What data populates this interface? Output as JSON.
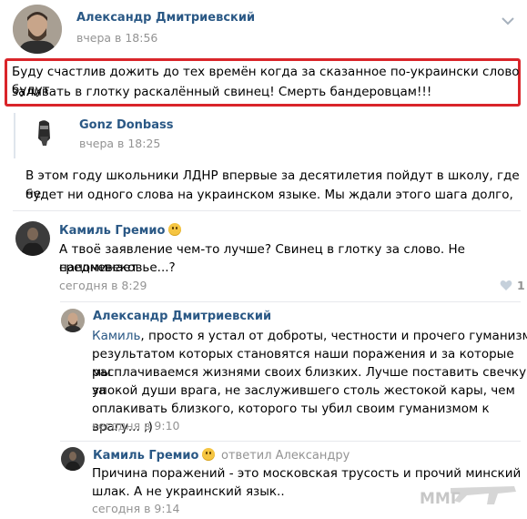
{
  "post": {
    "author": "Александр Дмитриевский",
    "time": "вчера в 18:56",
    "text_line1": "Буду счастлив дожить до тех времён когда за сказанное по-украински слово будут",
    "text_line2": "заливать в глотку раскалённый свинец! Смерть бандеровцам!!!",
    "menu_icon": "chevron-down-icon",
    "highlight_color": "#d9252a"
  },
  "repost": {
    "author": "Gonz Donbass",
    "time": "вчера в 18:25",
    "text_line1": "В этом году школьники ЛДНР впервые за десятилетия пойдут в школу, где не",
    "text_line2": "будет ни одного слова на украинском языке. Мы ждали этого шага долго,"
  },
  "comments": [
    {
      "author": "Камиль Гремио",
      "text_line1": "А твоё заявление чем-то лучше? Свинец в глотку за слово. Не напоминает",
      "text_line2": "средневековье...?",
      "time": "сегодня в 8:29",
      "likes": "1"
    },
    {
      "author": "Александр Дмитриевский",
      "reply_to": "Камиль",
      "text_line1": ", просто я устал от доброты, честности и прочего гуманизма,",
      "text_line2": "результатом которых становятся наши поражения и за которые мы",
      "text_line3": "расплачиваемся жизнями своих близких. Лучше поставить свечку за",
      "text_line4": "упокой души врага, не заслужившего столь жестокой кары, чем",
      "text_line5": "оплакивать близкого, которого ты убил своим гуманизмом к врагу... ;)",
      "time": "сегодня в 9:10"
    },
    {
      "author": "Камиль Гремио",
      "replied": "ответил Александру",
      "text_line1": "Причина поражений - это московская трусость и прочий минский",
      "text_line2": "шлак. А не украинский язык..",
      "time": "сегодня в 9:14"
    }
  ],
  "watermark": "ММГ",
  "colors": {
    "link": "#2a5885",
    "meta": "#939393"
  }
}
